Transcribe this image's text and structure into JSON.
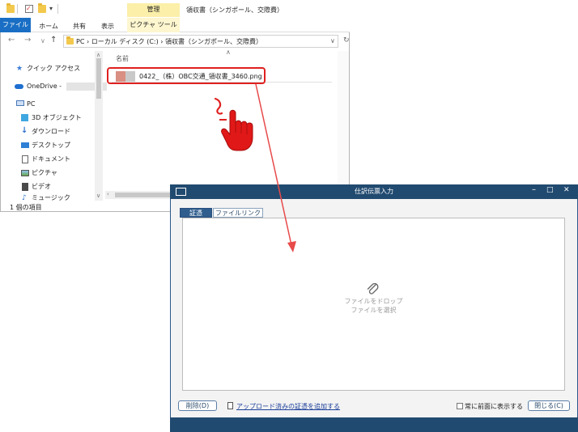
{
  "explorer": {
    "window_title": "領収書（シンガポール、交際費）",
    "manage_tab": "管理",
    "ribbon_tabs": [
      "ファイル",
      "ホーム",
      "共有",
      "表示",
      "ピクチャ ツール"
    ],
    "address_path": "PC  ›  ローカル ディスク (C:)  ›  領収書（シンガポール、交際費）",
    "nav_items": [
      {
        "label": "クイック アクセス",
        "icon": "star-icon"
      },
      {
        "label": "OneDrive -",
        "icon": "cloud-icon"
      },
      {
        "label": "PC",
        "icon": "pc-icon"
      },
      {
        "label": "3D オブジェクト",
        "icon": "cube-icon"
      },
      {
        "label": "ダウンロード",
        "icon": "download-icon"
      },
      {
        "label": "デスクトップ",
        "icon": "desktop-icon"
      },
      {
        "label": "ドキュメント",
        "icon": "document-icon"
      },
      {
        "label": "ピクチャ",
        "icon": "picture-icon"
      },
      {
        "label": "ビデオ",
        "icon": "video-icon"
      },
      {
        "label": "ミュージック",
        "icon": "music-icon"
      }
    ],
    "column_header": "名前",
    "file_name": "0422_（株）OBC交通_領収書_3460.png",
    "status": "1 個の項目"
  },
  "dialog": {
    "title": "仕訳伝票入力",
    "tabs": [
      "証憑",
      "ファイルリンク"
    ],
    "drop_line1": "ファイルをドロップ",
    "drop_line2": "ファイルを選択",
    "delete_button": "削除(D)",
    "add_link": "アップロード済みの証憑を追加する",
    "always_on_top": "常に前面に表示する",
    "close_button": "閉じる(C)"
  },
  "colors": {
    "highlight": "#e02020",
    "dialog_titlebar": "#214a70",
    "ribbon_file_tab": "#1a6fc4",
    "manage_tab": "#fbefa9"
  }
}
